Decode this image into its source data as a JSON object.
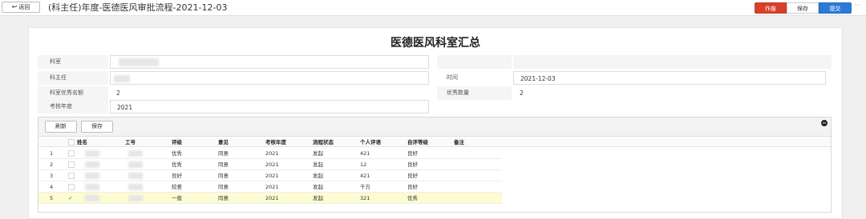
{
  "topbar": {
    "back_label": "返回",
    "page_title": "(科主任)年度-医德医风审批流程-2021-12-03",
    "void_label": "作废",
    "save_label": "保存",
    "submit_label": "提交",
    "more_label": "··"
  },
  "form": {
    "title": "医德医风科室汇总",
    "dept_label": "科室",
    "dept_value": "",
    "head_label": "科主任",
    "head_value": "",
    "time_label": "时间",
    "time_value": "2021-12-03",
    "excellent_quota_label": "科室优秀名额",
    "excellent_quota_value": "2",
    "excellent_count_label": "优秀数量",
    "excellent_count_value": "2",
    "assess_year_label": "考核年度",
    "assess_year_value": "2021"
  },
  "grid": {
    "refresh_label": "刷新",
    "save_label": "保存",
    "collapse_label": "−",
    "columns": [
      "姓名",
      "工号",
      "评级",
      "意见",
      "考核年度",
      "流程状态",
      "个人评语",
      "自评等级",
      "备注"
    ],
    "rows": [
      {
        "index": "1",
        "checked": "",
        "grade": "优秀",
        "opinion": "同意",
        "year": "2021",
        "status": "发起",
        "comment": "421",
        "self_grade": "良好",
        "note": ""
      },
      {
        "index": "2",
        "checked": "",
        "grade": "优秀",
        "opinion": "同意",
        "year": "2021",
        "status": "发起",
        "comment": "12",
        "self_grade": "良好",
        "note": ""
      },
      {
        "index": "3",
        "checked": "",
        "grade": "良好",
        "opinion": "同意",
        "year": "2021",
        "status": "发起",
        "comment": "421",
        "self_grade": "良好",
        "note": ""
      },
      {
        "index": "4",
        "checked": "",
        "grade": "较差",
        "opinion": "同意",
        "year": "2021",
        "status": "发起",
        "comment": "千万",
        "self_grade": "良好",
        "note": ""
      },
      {
        "index": "5",
        "checked": "✓",
        "grade": "一般",
        "opinion": "同意",
        "year": "2021",
        "status": "发起",
        "comment": "321",
        "self_grade": "优秀",
        "note": ""
      }
    ]
  },
  "colors": {
    "void_button": "#d9402a",
    "submit_button": "#2b7bd6",
    "highlight_row": "#fdfbd2"
  }
}
